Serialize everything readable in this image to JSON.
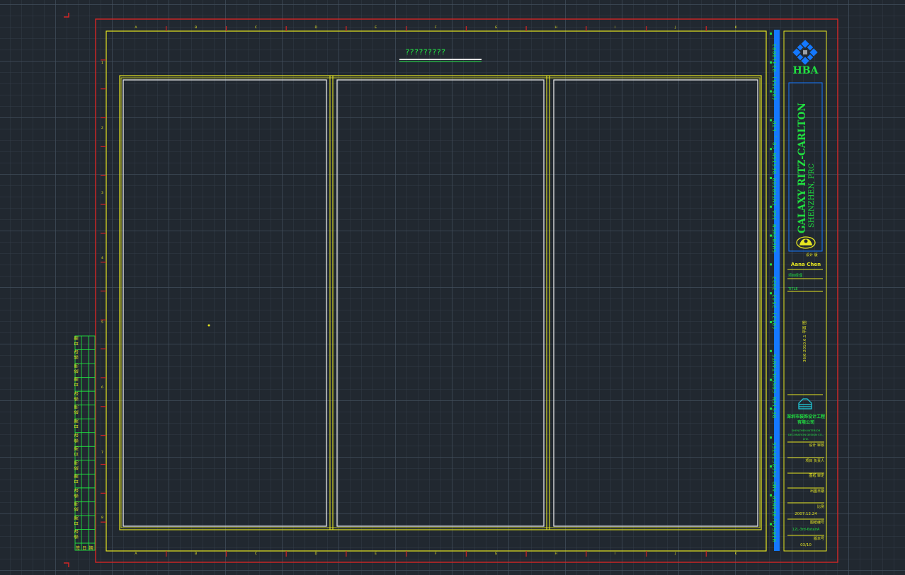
{
  "sheet_title": "?????????",
  "side_strip": {
    "company": "SHENZHEN J&A INTERIOR DESIGN CO., LTD",
    "phone_cn": "(86755)-83418081",
    "hk_line": "DESIGN CONSULTANTS",
    "phone_hk": "(852)-2542-2022",
    "firm": "HIRSCH/BEDNER AND ASSOCIATES"
  },
  "title_block": {
    "logo_text": "HBA",
    "project_name": "GALAXY RITZ-CARLTON",
    "project_location": "SHENZHEN, PRC",
    "label_a": "设计 版",
    "designer": "Aana Chen",
    "field_a": "项目经理",
    "field_b": "TITLE",
    "drawing_desc": "36/6 2010.6.1 平面 图",
    "consultant_cn": "深圳市装饰设计工程 有限公司",
    "consultant_en": "SHENZHEN INTERIOR DECORATION DESIGN CO., LTD.",
    "row1": "设计 审核",
    "row2": "项目 负责人",
    "row3": "图纸 审定",
    "row4": "出图日期",
    "row5": "比例",
    "date": "2007.12.24",
    "row6": "图纸编号",
    "sheet_no": "12L-3rd-6stairA",
    "row7": "版本号",
    "rev": "03/10"
  },
  "revision_table": {
    "cells": [
      "日 期",
      "修 改",
      "说 明",
      "日 期",
      "修 改",
      "说 明",
      "日 期",
      "修 改",
      "日 期",
      "说 明",
      "日 期",
      "修 改",
      "说 明",
      "日 期",
      "修 改"
    ],
    "footer": [
      "签",
      "日",
      "期"
    ]
  },
  "grid": {
    "col_letters": [
      "A",
      "B",
      "C",
      "D",
      "E",
      "F",
      "G",
      "H",
      "I",
      "J",
      "K"
    ],
    "row_numbers": [
      "1",
      "2",
      "3",
      "4",
      "5",
      "6",
      "7",
      "8"
    ]
  },
  "colors": {
    "background": "#212830",
    "red_border": "#d32525",
    "yellow": "#e6e621",
    "green": "#20e040",
    "white": "#e6e6e6",
    "blue_bar": "#1478ff"
  }
}
